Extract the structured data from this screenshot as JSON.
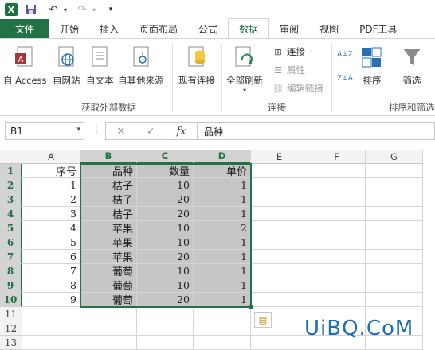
{
  "qat": {
    "app_icon": "X",
    "save_icon": "save-icon",
    "undo_icon": "undo-icon",
    "redo_icon": "redo-icon",
    "customize_icon": "customize-icon"
  },
  "tabs": [
    {
      "label": "文件"
    },
    {
      "label": "开始"
    },
    {
      "label": "插入"
    },
    {
      "label": "页面布局"
    },
    {
      "label": "公式"
    },
    {
      "label": "数据"
    },
    {
      "label": "审阅"
    },
    {
      "label": "视图"
    },
    {
      "label": "PDF工具"
    }
  ],
  "ribbon": {
    "get_external": {
      "buttons": [
        "自 Access",
        "自网站",
        "自文本",
        "自其他来源"
      ],
      "label": "获取外部数据"
    },
    "existing_connections": "现有连接",
    "connections": {
      "refresh_all": "全部刷新",
      "connections": "连接",
      "properties": "属性",
      "edit_links": "编辑链接",
      "label": "连接"
    },
    "sort_filter": {
      "sort": "排序",
      "filter": "筛选",
      "label": "排序和筛选"
    }
  },
  "formula_bar": {
    "name_box": "B1",
    "cancel": "✕",
    "enter": "✓",
    "fx": "fx",
    "content": "品种"
  },
  "sheet": {
    "columns": [
      "A",
      "B",
      "C",
      "D",
      "E",
      "F",
      "G"
    ],
    "row_numbers": [
      "1",
      "2",
      "3",
      "4",
      "5",
      "6",
      "7",
      "8",
      "9",
      "10",
      "11",
      "12",
      "13"
    ],
    "header": [
      "序号",
      "品种",
      "数量",
      "单价"
    ],
    "rows": [
      [
        "1",
        "桔子",
        "10",
        "1"
      ],
      [
        "2",
        "桔子",
        "20",
        "1"
      ],
      [
        "3",
        "桔子",
        "20",
        "1"
      ],
      [
        "4",
        "苹果",
        "10",
        "2"
      ],
      [
        "5",
        "苹果",
        "10",
        "1"
      ],
      [
        "6",
        "苹果",
        "20",
        "1"
      ],
      [
        "7",
        "葡萄",
        "10",
        "1"
      ],
      [
        "8",
        "葡萄",
        "10",
        "1"
      ],
      [
        "9",
        "葡萄",
        "20",
        "1"
      ]
    ]
  },
  "watermark": "UiBQ.CoM",
  "colors": {
    "accent": "#217346",
    "selection": "#c6c6c6",
    "watermark": "#1a6fb5"
  }
}
